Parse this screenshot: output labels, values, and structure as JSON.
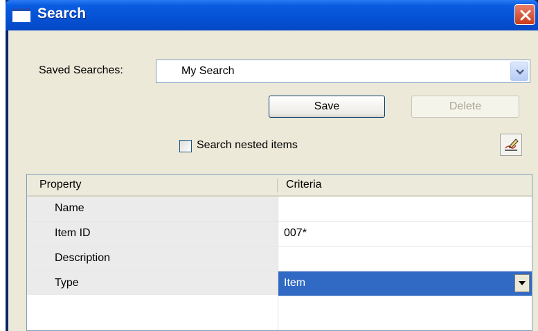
{
  "window": {
    "title": "Search",
    "icons": {
      "title": "window-icon",
      "close": "close-icon"
    },
    "colors": {
      "titlebar": "#0552d6",
      "close": "#c93b1a",
      "selection": "#316ac5"
    }
  },
  "saved_searches": {
    "label": "Saved Searches:",
    "value": "My Search",
    "dropdown_icon": "chevron-down-icon"
  },
  "buttons": {
    "save": "Save",
    "delete": "Delete",
    "edit_icon": "edit-icon"
  },
  "options": {
    "search_nested_label": "Search nested items",
    "search_nested_checked": false
  },
  "grid": {
    "headers": {
      "property": "Property",
      "criteria": "Criteria"
    },
    "rows": [
      {
        "property": "Name",
        "criteria": ""
      },
      {
        "property": "Item ID",
        "criteria": "007*"
      },
      {
        "property": "Description",
        "criteria": ""
      },
      {
        "property": "Type",
        "criteria": "Item",
        "selected": true
      }
    ]
  }
}
